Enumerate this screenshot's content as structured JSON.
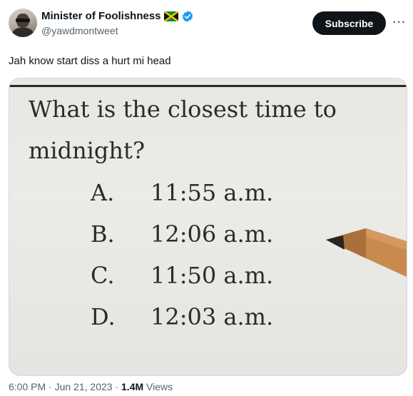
{
  "author": {
    "display_name": "Minister of Foolishness",
    "handle": "@yawdmontweet",
    "flag": "jamaica-flag",
    "verified_color": "#1d9bf0"
  },
  "actions": {
    "subscribe_label": "Subscribe",
    "more_label": "···"
  },
  "tweet": {
    "text": "Jah know start diss a hurt mi head"
  },
  "image": {
    "question_line1": "What is the closest time to",
    "question_line2": "midnight?",
    "options": [
      {
        "letter": "A.",
        "time": "11:55 a.m."
      },
      {
        "letter": "B.",
        "time": "12:06 a.m."
      },
      {
        "letter": "C.",
        "time": "11:50 a.m."
      },
      {
        "letter": "D.",
        "time": "12:03 a.m."
      }
    ]
  },
  "meta": {
    "time": "6:00 PM",
    "separator": "·",
    "date": "Jun 21, 2023",
    "views_count": "1.4M",
    "views_label": "Views"
  }
}
